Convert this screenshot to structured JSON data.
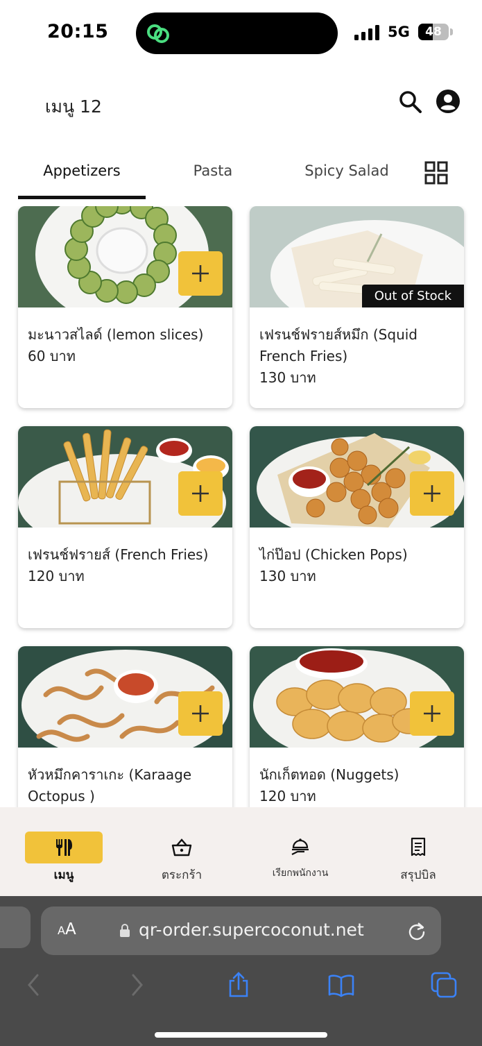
{
  "status_bar": {
    "time": "20:15",
    "network": "5G",
    "battery": "48",
    "battery_level": 0.48
  },
  "header": {
    "title": "เมนู 12"
  },
  "tabs": [
    {
      "label": "Appetizers",
      "active": true
    },
    {
      "label": "Pasta",
      "active": false
    },
    {
      "label": "Spicy Salad",
      "active": false
    }
  ],
  "products": [
    {
      "name": "มะนาวสไลด์ (lemon slices)",
      "price": "60 บาท",
      "out_of_stock": false,
      "image": "lemon-slices-photo"
    },
    {
      "name": "เฟรนช์ฟรายส์หมึก (Squid French Fries)",
      "price": "130 บาท",
      "out_of_stock": true,
      "image": "squid-fries-photo"
    },
    {
      "name": "เฟรนช์ฟรายส์ (French Fries)",
      "price": "120 บาท",
      "out_of_stock": false,
      "image": "french-fries-photo"
    },
    {
      "name": "ไก่ป๊อป (Chicken Pops)",
      "price": "130 บาท",
      "out_of_stock": false,
      "image": "chicken-pops-photo"
    },
    {
      "name": "หัวหมึกคาราเกะ (Karaage Octopus )",
      "price": "",
      "out_of_stock": false,
      "image": "karaage-octopus-photo"
    },
    {
      "name": "นักเก็ตทอด (Nuggets)",
      "price": "120 บาท",
      "out_of_stock": false,
      "image": "nuggets-photo"
    }
  ],
  "badges": {
    "out_of_stock": "Out of Stock"
  },
  "bottom_nav": [
    {
      "label": "เมนู",
      "icon": "utensils-icon",
      "active": true
    },
    {
      "label": "ตระกร้า",
      "icon": "basket-icon",
      "active": false
    },
    {
      "label": "เรียกพนักงาน",
      "icon": "call-staff-icon",
      "active": false
    },
    {
      "label": "สรุปบิล",
      "icon": "receipt-icon",
      "active": false
    }
  ],
  "browser": {
    "text_size_label": "AA",
    "url": "qr-order.supercoconut.net"
  },
  "colors": {
    "accent": "#f1c23a",
    "nav_background": "#f4f0ee",
    "browser_chrome": "#4a4a4a",
    "safari_blue": "#3b82f6"
  }
}
